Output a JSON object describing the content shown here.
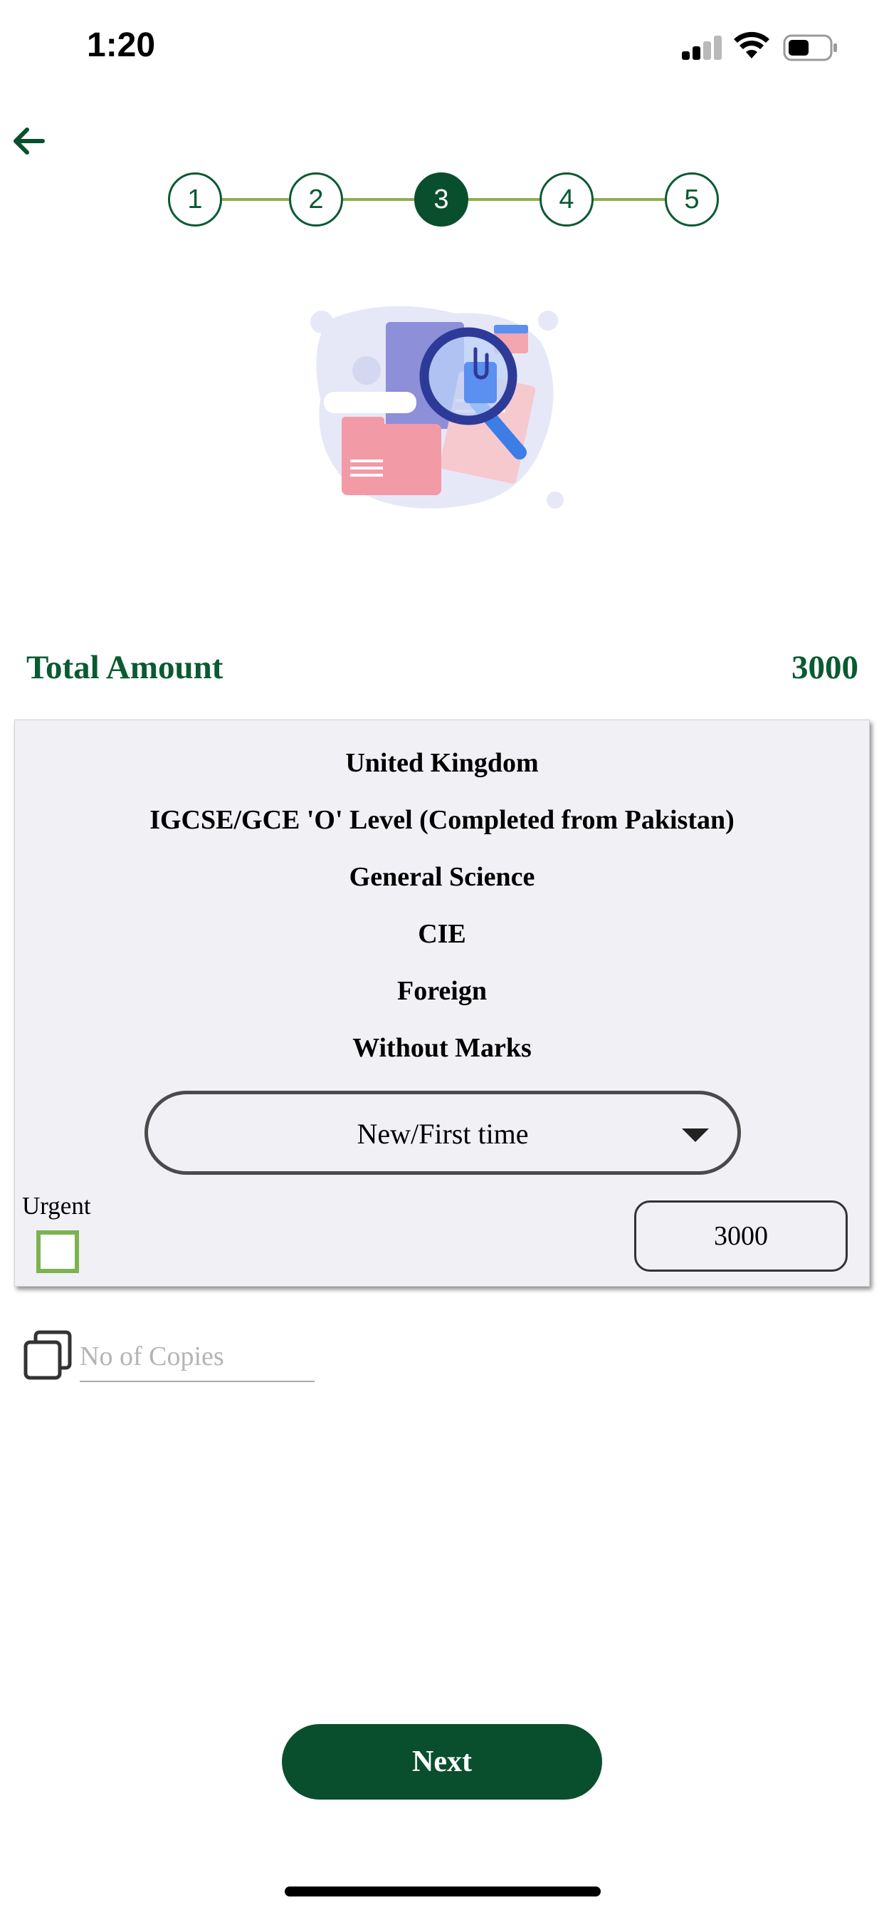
{
  "status_bar": {
    "time": "1:20"
  },
  "stepper": {
    "steps": [
      "1",
      "2",
      "3",
      "4",
      "5"
    ],
    "active_step": 3
  },
  "total": {
    "label": "Total Amount",
    "value": "3000"
  },
  "details": {
    "country": "United Kingdom",
    "qualification": "IGCSE/GCE 'O' Level (Completed from Pakistan)",
    "group": "General Science",
    "board": "CIE",
    "type": "Foreign",
    "marks_option": "Without Marks",
    "request_type_selected": "New/First time",
    "urgent_label": "Urgent",
    "urgent_checked": false,
    "amount": "3000"
  },
  "copies": {
    "placeholder": "No of Copies",
    "value": ""
  },
  "next_button_label": "Next",
  "colors": {
    "brand_green": "#0a4f2d",
    "accent_green": "#8ab04e",
    "card_bg": "#f0f0f5"
  },
  "icons": {
    "back": "arrow-left-icon",
    "copies": "copy-icon",
    "dropdown": "caret-down-icon"
  }
}
